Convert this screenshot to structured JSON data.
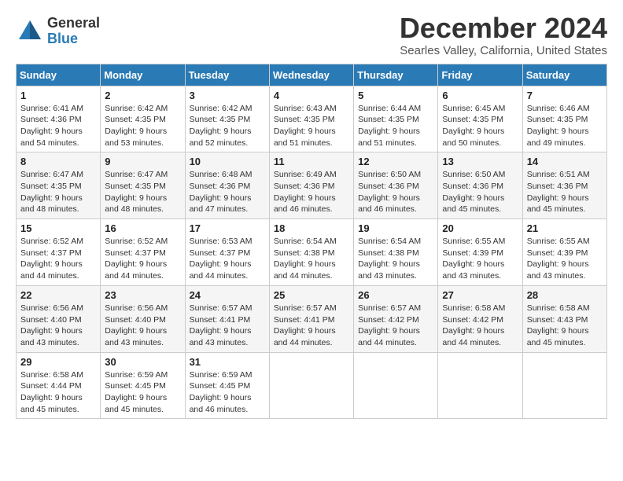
{
  "logo": {
    "general": "General",
    "blue": "Blue"
  },
  "title": "December 2024",
  "location": "Searles Valley, California, United States",
  "days_of_week": [
    "Sunday",
    "Monday",
    "Tuesday",
    "Wednesday",
    "Thursday",
    "Friday",
    "Saturday"
  ],
  "weeks": [
    [
      {
        "day": "1",
        "sunrise": "6:41 AM",
        "sunset": "4:36 PM",
        "daylight": "9 hours and 54 minutes."
      },
      {
        "day": "2",
        "sunrise": "6:42 AM",
        "sunset": "4:35 PM",
        "daylight": "9 hours and 53 minutes."
      },
      {
        "day": "3",
        "sunrise": "6:42 AM",
        "sunset": "4:35 PM",
        "daylight": "9 hours and 52 minutes."
      },
      {
        "day": "4",
        "sunrise": "6:43 AM",
        "sunset": "4:35 PM",
        "daylight": "9 hours and 51 minutes."
      },
      {
        "day": "5",
        "sunrise": "6:44 AM",
        "sunset": "4:35 PM",
        "daylight": "9 hours and 51 minutes."
      },
      {
        "day": "6",
        "sunrise": "6:45 AM",
        "sunset": "4:35 PM",
        "daylight": "9 hours and 50 minutes."
      },
      {
        "day": "7",
        "sunrise": "6:46 AM",
        "sunset": "4:35 PM",
        "daylight": "9 hours and 49 minutes."
      }
    ],
    [
      {
        "day": "8",
        "sunrise": "6:47 AM",
        "sunset": "4:35 PM",
        "daylight": "9 hours and 48 minutes."
      },
      {
        "day": "9",
        "sunrise": "6:47 AM",
        "sunset": "4:35 PM",
        "daylight": "9 hours and 48 minutes."
      },
      {
        "day": "10",
        "sunrise": "6:48 AM",
        "sunset": "4:36 PM",
        "daylight": "9 hours and 47 minutes."
      },
      {
        "day": "11",
        "sunrise": "6:49 AM",
        "sunset": "4:36 PM",
        "daylight": "9 hours and 46 minutes."
      },
      {
        "day": "12",
        "sunrise": "6:50 AM",
        "sunset": "4:36 PM",
        "daylight": "9 hours and 46 minutes."
      },
      {
        "day": "13",
        "sunrise": "6:50 AM",
        "sunset": "4:36 PM",
        "daylight": "9 hours and 45 minutes."
      },
      {
        "day": "14",
        "sunrise": "6:51 AM",
        "sunset": "4:36 PM",
        "daylight": "9 hours and 45 minutes."
      }
    ],
    [
      {
        "day": "15",
        "sunrise": "6:52 AM",
        "sunset": "4:37 PM",
        "daylight": "9 hours and 44 minutes."
      },
      {
        "day": "16",
        "sunrise": "6:52 AM",
        "sunset": "4:37 PM",
        "daylight": "9 hours and 44 minutes."
      },
      {
        "day": "17",
        "sunrise": "6:53 AM",
        "sunset": "4:37 PM",
        "daylight": "9 hours and 44 minutes."
      },
      {
        "day": "18",
        "sunrise": "6:54 AM",
        "sunset": "4:38 PM",
        "daylight": "9 hours and 44 minutes."
      },
      {
        "day": "19",
        "sunrise": "6:54 AM",
        "sunset": "4:38 PM",
        "daylight": "9 hours and 43 minutes."
      },
      {
        "day": "20",
        "sunrise": "6:55 AM",
        "sunset": "4:39 PM",
        "daylight": "9 hours and 43 minutes."
      },
      {
        "day": "21",
        "sunrise": "6:55 AM",
        "sunset": "4:39 PM",
        "daylight": "9 hours and 43 minutes."
      }
    ],
    [
      {
        "day": "22",
        "sunrise": "6:56 AM",
        "sunset": "4:40 PM",
        "daylight": "9 hours and 43 minutes."
      },
      {
        "day": "23",
        "sunrise": "6:56 AM",
        "sunset": "4:40 PM",
        "daylight": "9 hours and 43 minutes."
      },
      {
        "day": "24",
        "sunrise": "6:57 AM",
        "sunset": "4:41 PM",
        "daylight": "9 hours and 43 minutes."
      },
      {
        "day": "25",
        "sunrise": "6:57 AM",
        "sunset": "4:41 PM",
        "daylight": "9 hours and 44 minutes."
      },
      {
        "day": "26",
        "sunrise": "6:57 AM",
        "sunset": "4:42 PM",
        "daylight": "9 hours and 44 minutes."
      },
      {
        "day": "27",
        "sunrise": "6:58 AM",
        "sunset": "4:42 PM",
        "daylight": "9 hours and 44 minutes."
      },
      {
        "day": "28",
        "sunrise": "6:58 AM",
        "sunset": "4:43 PM",
        "daylight": "9 hours and 45 minutes."
      }
    ],
    [
      {
        "day": "29",
        "sunrise": "6:58 AM",
        "sunset": "4:44 PM",
        "daylight": "9 hours and 45 minutes."
      },
      {
        "day": "30",
        "sunrise": "6:59 AM",
        "sunset": "4:45 PM",
        "daylight": "9 hours and 45 minutes."
      },
      {
        "day": "31",
        "sunrise": "6:59 AM",
        "sunset": "4:45 PM",
        "daylight": "9 hours and 46 minutes."
      },
      null,
      null,
      null,
      null
    ]
  ]
}
